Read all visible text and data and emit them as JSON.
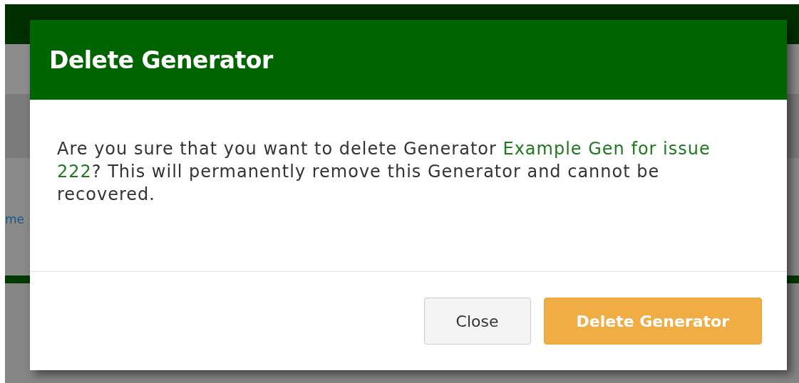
{
  "page": {
    "link_fragment": "me"
  },
  "dialog": {
    "title": "Delete Generator",
    "message": {
      "before": "Are you sure that you want to delete Generator ",
      "generator_name": "Example Gen for issue 222",
      "after": "? This will permanently remove this Generator and cannot be recovered."
    },
    "buttons": [
      {
        "label": "Close",
        "kind": "secondary"
      },
      {
        "label": "Delete Generator",
        "kind": "primary"
      }
    ]
  }
}
